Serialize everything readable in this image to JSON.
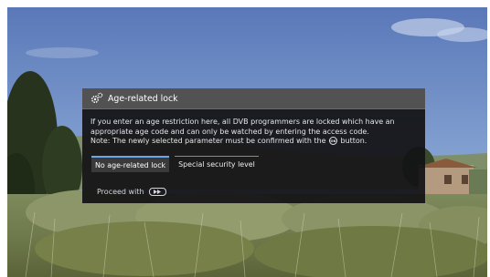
{
  "dialog": {
    "title": "Age-related lock",
    "icon": "gear-icon",
    "text_line1": "If you enter an age restriction here, all DVB programmers are locked which have an",
    "text_line2": "appropriate age code and can only be watched by entering the access code.",
    "text_line3_before": "Note: The newly selected parameter must be confirmed with the ",
    "ok_label": "OK",
    "text_line3_after": " button.",
    "options": [
      {
        "label": "No age-related lock",
        "selected": true
      },
      {
        "label": "Special security level",
        "selected": false
      }
    ],
    "footer_label": "Proceed with",
    "footer_icon": "fast-forward-button-icon"
  },
  "colors": {
    "accent": "#6aa6e8",
    "dialog_bg": "#121214",
    "header_bg": "#525252"
  }
}
